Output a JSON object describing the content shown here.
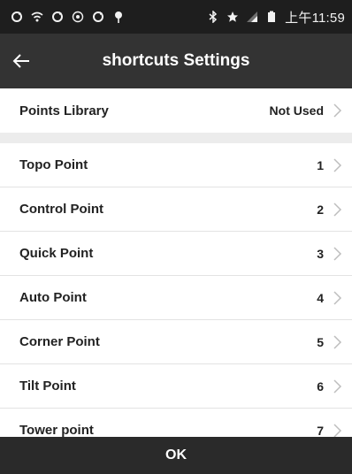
{
  "status_bar": {
    "time": "上午11:59",
    "icons": [
      "sync-icon",
      "wifi-icon",
      "sync-icon",
      "target-icon",
      "sync-icon",
      "pin-icon"
    ],
    "right_icons": [
      "bluetooth-icon",
      "star-icon",
      "signal-icon",
      "battery-icon"
    ]
  },
  "header": {
    "title": "shortcuts Settings",
    "back_icon": "back-arrow-icon"
  },
  "points_library": {
    "label": "Points Library",
    "value": "Not Used"
  },
  "items": [
    {
      "label": "Topo Point",
      "value": "1"
    },
    {
      "label": "Control Point",
      "value": "2"
    },
    {
      "label": "Quick Point",
      "value": "3"
    },
    {
      "label": "Auto Point",
      "value": "4"
    },
    {
      "label": "Corner Point",
      "value": "5"
    },
    {
      "label": "Tilt Point",
      "value": "6"
    },
    {
      "label": "Tower point",
      "value": "7"
    }
  ],
  "footer": {
    "ok_label": "OK"
  },
  "colors": {
    "status_bar": "#1e1e1e",
    "app_bar": "#333333",
    "footer": "#2a2a2a",
    "separator": "#ececec"
  }
}
